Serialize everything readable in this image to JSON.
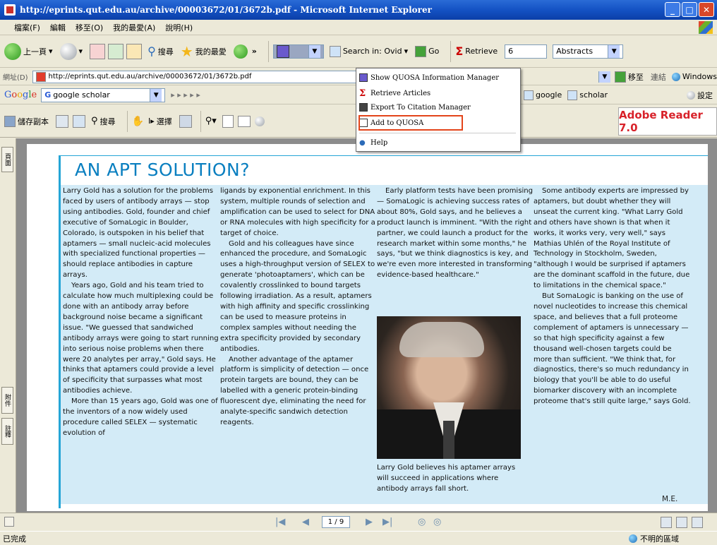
{
  "window": {
    "title": "http://eprints.qut.edu.au/archive/00003672/01/3672b.pdf - Microsoft Internet Explorer"
  },
  "menu": [
    "檔案(F)",
    "編輯",
    "移至(O)",
    "我的最愛(A)",
    "說明(H)"
  ],
  "toolbar": {
    "back_label": "上一頁",
    "search_label": "搜尋",
    "favorites_label": "我的最愛",
    "search_in_label": "Search in: Ovid",
    "go_label": "Go",
    "retrieve_label": "Retrieve",
    "retrieve_value": "6",
    "abstracts_value": "Abstracts"
  },
  "address_bar": {
    "label": "網址(D)",
    "value": "http://eprints.qut.edu.au/archive/00003672/01/3672b.pdf",
    "go_label": "移至",
    "links_label": "連結",
    "windows_label": "Windows"
  },
  "google_bar": {
    "logo_G": "G",
    "logo_o1": "o",
    "logo_o2": "o",
    "logo_g": "g",
    "logo_l": "l",
    "logo_e": "e",
    "search_value": "google scholar",
    "search_google": "google",
    "search_scholar": "scholar",
    "settings_label": "設定"
  },
  "reader_toolbar": {
    "save_copy_label": "儲存副本",
    "search_label": "搜尋",
    "select_label": "選擇",
    "adobe_label": "Adobe Reader 7.0"
  },
  "quosa_menu": {
    "items": [
      {
        "label": "Show QUOSA Information Manager"
      },
      {
        "label": "Retrieve Articles"
      },
      {
        "label": "Export To Citation Manager"
      },
      {
        "label": "Add to QUOSA"
      },
      {
        "label": "Help"
      }
    ]
  },
  "left_panel": {
    "tabs": [
      "頁面",
      "附件",
      "註釋"
    ]
  },
  "article": {
    "headline": "AN APT SOLUTION?",
    "col1": [
      {
        "indent": false,
        "text": "Larry Gold has a solution for the problems faced by users of antibody arrays — stop using antibodies. Gold, founder and chief executive of SomaLogic in Boulder, Colorado, is outspoken in his belief that aptamers — small nucleic-acid molecules with specialized functional properties — should replace antibodies in capture arrays."
      },
      {
        "indent": true,
        "text": "Years ago, Gold and his team tried to calculate how much multiplexing could be done with an antibody array before background noise became a significant issue. \"We guessed that sandwiched antibody arrays were going to start running into serious noise problems when there were 20 analytes per array,\" Gold says. He thinks that aptamers could provide a level of specificity that surpasses what most antibodies achieve."
      },
      {
        "indent": true,
        "text": "More than 15 years ago, Gold was one of the inventors of a now widely used procedure called SELEX — systematic evolution of"
      }
    ],
    "col2": [
      {
        "indent": false,
        "text": "ligands by exponential enrichment. In this system, multiple rounds of selection and amplification can be used to select for DNA or RNA molecules with high specificity for a target of choice."
      },
      {
        "indent": true,
        "text": "Gold and his colleagues have since enhanced the procedure, and SomaLogic uses a high-throughput version of SELEX to generate 'photoaptamers', which can be covalently crosslinked to bound targets following irradiation. As a result, aptamers with high affinity and specific crosslinking can be used to measure proteins in complex samples without needing the extra specificity provided by secondary antibodies."
      },
      {
        "indent": true,
        "text": "Another advantage of the aptamer platform is simplicity of detection — once protein targets are bound, they can be labelled with a generic protein-binding fluorescent dye, eliminating the need for analyte-specific sandwich detection reagents."
      }
    ],
    "col3": [
      {
        "indent": true,
        "text": "Early platform tests have been promising — SomaLogic is achieving success rates of about 80%, Gold says, and he believes a product launch is imminent. \"With the right partner, we could launch a product for the research market within some months,\" he says, \"but we think diagnostics is key, and we're even more interested in transforming evidence-based healthcare.\""
      }
    ],
    "caption": "Larry Gold believes his aptamer arrays will succeed in applications where antibody arrays fall short.",
    "col4": [
      {
        "indent": true,
        "text": "Some antibody experts are impressed by aptamers, but doubt whether they will unseat the current king. \"What Larry Gold and others have shown is that when it works, it works very, very well,\" says Mathias Uhlén of the Royal Institute of Technology in Stockholm, Sweden, \"although I would be surprised if aptamers are the dominant scaffold in the future, due to limitations in the chemical space.\""
      },
      {
        "indent": true,
        "text": "But SomaLogic is banking on the use of novel nucleotides to increase this chemical space, and believes that a full proteome complement of aptamers is unnecessary — so that high specificity against a few thousand well-chosen targets could be more than sufficient. \"We think that, for diagnostics, there's so much redundancy in biology that you'll be able to do useful biomarker discovery with an incomplete proteome that's still quite large,\" says Gold."
      }
    ],
    "initials": "M.E."
  },
  "navigation": {
    "page_indicator": "1 / 9"
  },
  "status": {
    "left": "已完成",
    "zone": "不明的區域"
  }
}
